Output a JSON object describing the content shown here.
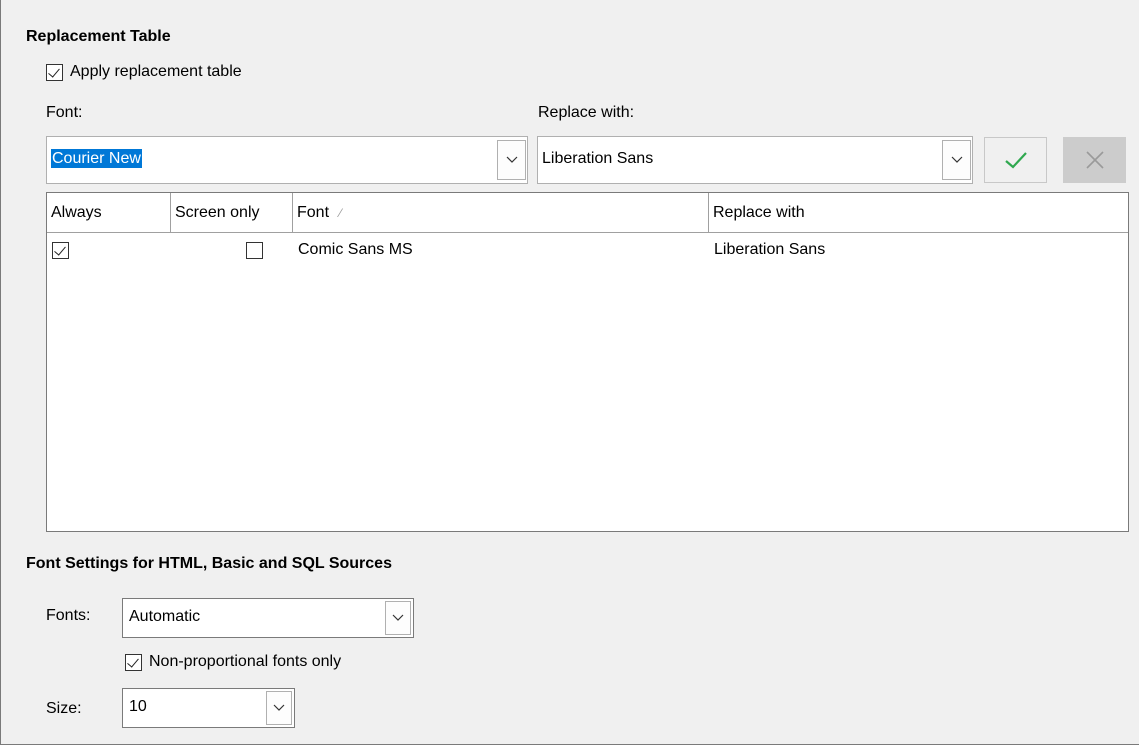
{
  "replacement": {
    "section_title": "Replacement Table",
    "apply_checkbox_label": "Apply replacement table",
    "apply_checked": true,
    "font_label": "Font:",
    "replace_with_label": "Replace with:",
    "font_value": "Courier New",
    "replace_value": "Liberation Sans",
    "apply_icon": "checkmark-icon",
    "delete_icon": "close-icon",
    "accent_check_color": "#2fa84f",
    "selection_color": "#0078d7"
  },
  "table": {
    "columns": [
      "Always",
      "Screen only",
      "Font",
      "Replace with"
    ],
    "sort_indicator": "⁄",
    "rows": [
      {
        "always": true,
        "screen_only": false,
        "font": "Comic Sans MS",
        "replace_with": "Liberation Sans"
      }
    ]
  },
  "font_settings": {
    "section_title": "Font Settings for HTML, Basic and SQL Sources",
    "fonts_label": "Fonts:",
    "fonts_value": "Automatic",
    "nonprop_label": "Non-proportional fonts only",
    "nonprop_checked": true,
    "size_label": "Size:",
    "size_value": "10"
  }
}
